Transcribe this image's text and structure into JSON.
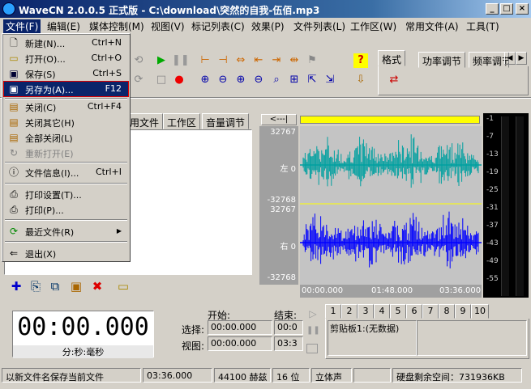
{
  "app": {
    "title": "WaveCN 2.0.0.5 正式版 - C:\\download\\突然的自我-伍佰.mp3",
    "window_buttons": [
      "_",
      "□",
      "×"
    ]
  },
  "menubar": [
    {
      "label": "文件(F)"
    },
    {
      "label": "编辑(E)"
    },
    {
      "label": "媒体控制(M)"
    },
    {
      "label": "视图(V)"
    },
    {
      "label": "标记列表(C)"
    },
    {
      "label": "效果(P)"
    },
    {
      "label": "文件列表(L)"
    },
    {
      "label": "工作区(W)"
    },
    {
      "label": "常用文件(A)"
    },
    {
      "label": "工具(T)"
    }
  ],
  "file_menu": {
    "items": [
      {
        "label": "新建(N)...",
        "shortcut": "Ctrl+N",
        "icon": "new-file-icon"
      },
      {
        "label": "打开(O)...",
        "shortcut": "Ctrl+O",
        "icon": "open-folder-icon"
      },
      {
        "label": "保存(S)",
        "shortcut": "Ctrl+S",
        "icon": "save-icon"
      },
      {
        "label": "另存为(A)...",
        "shortcut": "F12",
        "icon": "save-as-icon",
        "highlighted": true
      },
      {
        "label": "关闭(C)",
        "shortcut": "Ctrl+F4",
        "icon": "close-file-icon"
      },
      {
        "label": "关闭其它(H)",
        "shortcut": "",
        "icon": "close-others-icon"
      },
      {
        "label": "全部关闭(L)",
        "shortcut": "",
        "icon": "close-all-icon"
      },
      {
        "label": "重新打开(E)",
        "shortcut": "",
        "icon": "reopen-icon",
        "disabled": true
      },
      {
        "label": "文件信息(I)...",
        "shortcut": "Ctrl+I",
        "icon": "file-info-icon"
      },
      {
        "label": "打印设置(T)...",
        "shortcut": "",
        "icon": "print-setup-icon"
      },
      {
        "label": "打印(P)...",
        "shortcut": "",
        "icon": "print-icon"
      },
      {
        "label": "最近文件(R)",
        "shortcut": "",
        "icon": "recent-files-icon",
        "submenu": "▶"
      },
      {
        "label": "退出(X)",
        "shortcut": "",
        "icon": "exit-icon"
      }
    ]
  },
  "right_tabs": [
    "格式",
    "功率调节",
    "频率调节"
  ],
  "right_tab_arrows": [
    "◀",
    "▶"
  ],
  "left_tabs": [
    "用文件",
    "工作区",
    "音量调节"
  ],
  "wave": {
    "top_bar_label": "<---|",
    "left_scale": [
      "32767",
      "左 0",
      "-32768",
      "32767",
      "右 0",
      "-32768"
    ],
    "time_marks": [
      "00:00.000",
      "01:48.000",
      "03:36.000"
    ],
    "colors": {
      "left_channel": "#00a0a0",
      "right_channel": "#0000ff",
      "progress": "#ffff00"
    }
  },
  "meter_scale": [
    "-1",
    "-7",
    "-13",
    "-19",
    "-25",
    "-31",
    "-37",
    "-43",
    "-49",
    "-55"
  ],
  "position": {
    "clock": "00:00.000",
    "clock_unit": "分:秒:毫秒",
    "start_label": "开始:",
    "end_label": "结束:",
    "select_label": "选择:",
    "view_label": "视图:",
    "select_start": "00:00.000",
    "select_end": "00:0",
    "view_start": "00:00.000",
    "view_end": "03:3"
  },
  "clipboard": {
    "tabs": [
      "1",
      "2",
      "3",
      "4",
      "5",
      "6",
      "7",
      "8",
      "9",
      "10"
    ],
    "text": "剪贴板1:(无数据)"
  },
  "status": {
    "message": "以新文件名保存当前文件",
    "duration": "03:36.000",
    "sample_rate": "44100 赫兹",
    "bits": "16 位",
    "channels": "立体声",
    "disk": "硬盘剩余空间：731936KB"
  }
}
